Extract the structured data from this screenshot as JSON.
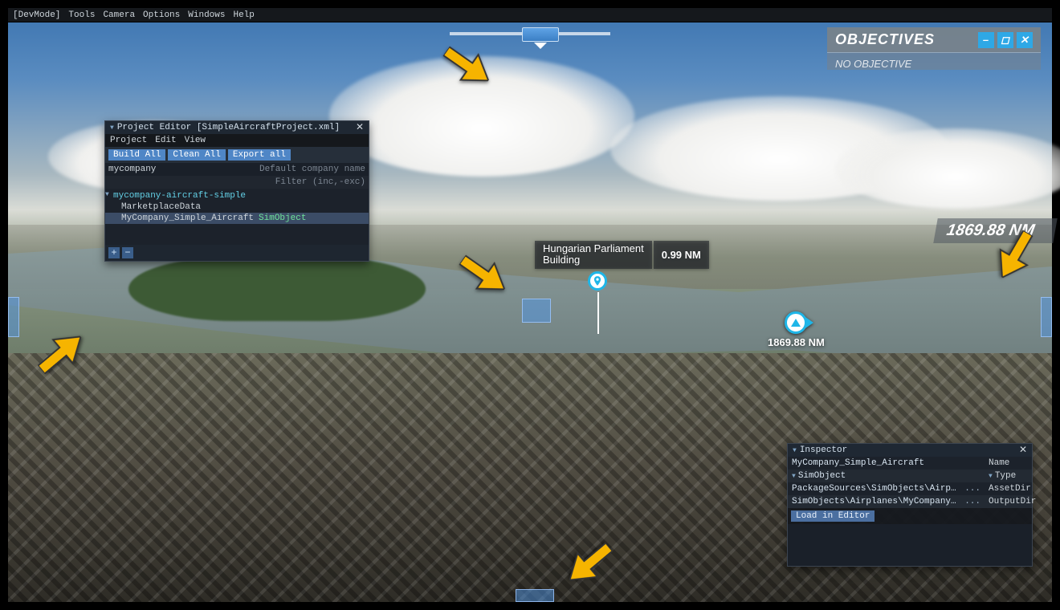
{
  "menubar": {
    "items": [
      "[DevMode]",
      "Tools",
      "Camera",
      "Options",
      "Windows",
      "Help"
    ]
  },
  "objectives": {
    "title": "OBJECTIVES",
    "body": "NO OBJECTIVE"
  },
  "project_editor": {
    "title": "Project Editor [SimpleAircraftProject.xml]",
    "menus": [
      "Project",
      "Edit",
      "View"
    ],
    "buttons": {
      "build": "Build All",
      "clean": "Clean All",
      "export": "Export all"
    },
    "company": "mycompany",
    "company_hint": "Default company name",
    "filter_hint": "Filter (inc,-exc)",
    "tree": {
      "root": "mycompany-aircraft-simple",
      "marketplace": "MarketplaceData",
      "item_name": "MyCompany_Simple_Aircraft",
      "item_tag": "SimObject"
    }
  },
  "inspector": {
    "title": "Inspector",
    "name_value": "MyCompany_Simple_Aircraft",
    "name_label": "Name",
    "type_value": "SimObject",
    "type_label": "Type",
    "assetdir_value": "PackageSources\\SimObjects\\Airplanes\\MyComp",
    "assetdir_label": "AssetDir",
    "outputdir_value": "SimObjects\\Airplanes\\MyCompany_Simple_Airc",
    "outputdir_label": "OutputDir",
    "dots": "...",
    "load": "Load in Editor"
  },
  "poi": {
    "name": "Hungarian Parliament\nBuilding",
    "distance": "0.99 NM"
  },
  "waypoint": {
    "distance": "1869.88 NM"
  },
  "big_distance": "1869.88 NM"
}
